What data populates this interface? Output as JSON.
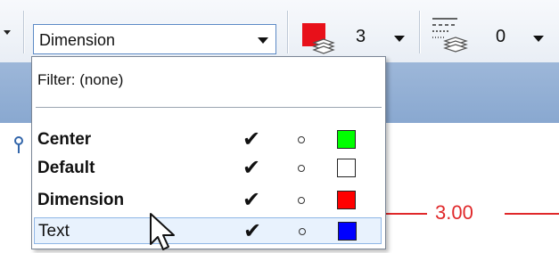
{
  "toolbar": {
    "level_combo_value": "Dimension",
    "color_value": "3",
    "style_value": "0"
  },
  "dropdown": {
    "filter_label": "Filter: (none)",
    "items": [
      {
        "label": "Center",
        "bold": true,
        "checked": true,
        "swatch_color": "#00ff00"
      },
      {
        "label": "Default",
        "bold": true,
        "checked": true,
        "swatch_color": "#ffffff"
      },
      {
        "label": "Dimension",
        "bold": true,
        "checked": true,
        "swatch_color": "#ff0000"
      },
      {
        "label": "Text",
        "bold": false,
        "checked": true,
        "swatch_color": "#0000ff"
      }
    ]
  },
  "canvas": {
    "dimension_text": "3.00"
  },
  "colors": {
    "accent_red": "#e0282a",
    "highlight_blue": "#e8f2fd",
    "band_blue": "#9db7d9"
  },
  "icons": {
    "checkmark": "✔"
  }
}
